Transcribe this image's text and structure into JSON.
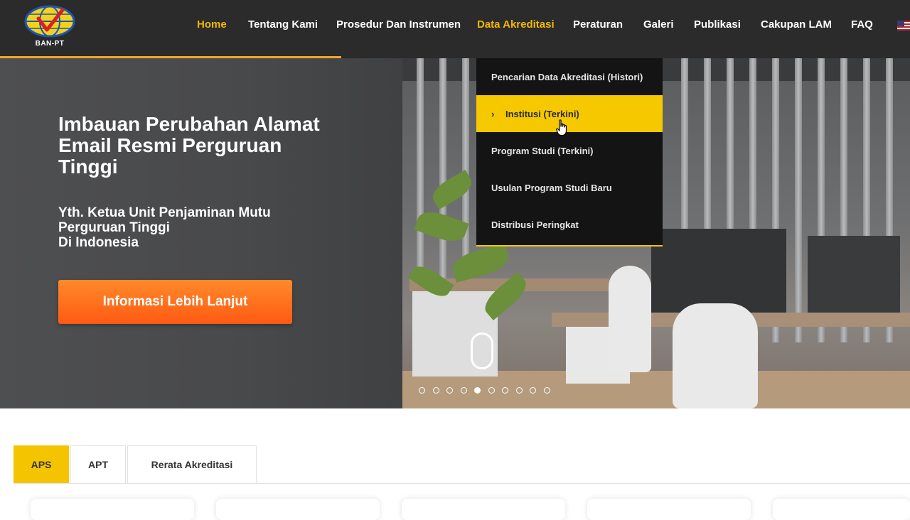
{
  "logo": {
    "text": "BAN-PT"
  },
  "nav": {
    "items": [
      {
        "label": "Home"
      },
      {
        "label": "Tentang Kami"
      },
      {
        "label": "Prosedur Dan Instrumen"
      },
      {
        "label": "Data Akreditasi"
      },
      {
        "label": "Peraturan"
      },
      {
        "label": "Galeri"
      },
      {
        "label": "Publikasi"
      },
      {
        "label": "Cakupan LAM"
      },
      {
        "label": "FAQ"
      }
    ],
    "active_color": "#f5b800"
  },
  "dropdown": {
    "items": [
      {
        "label": "Pencarian Data Akreditasi (Histori)"
      },
      {
        "label": "Institusi (Terkini)",
        "chevron": "›"
      },
      {
        "label": "Program Studi (Terkini)"
      },
      {
        "label": "Usulan Program Studi Baru"
      },
      {
        "label": "Distribusi Peringkat"
      }
    ],
    "hover_color": "#f5c800"
  },
  "hero": {
    "title": "Imbauan Perubahan Alamat Email Resmi Perguruan Tinggi",
    "subtitle": "Yth. Ketua Unit Penjaminan Mutu\nPerguruan Tinggi\nDi Indonesia",
    "button_label": "Informasi Lebih Lanjut",
    "button_color": "#ff6a1a",
    "slides_total": 10,
    "active_slide": 5
  },
  "tabs": {
    "items": [
      {
        "label": "APS"
      },
      {
        "label": "APT"
      },
      {
        "label": "Rerata Akreditasi"
      }
    ],
    "active_color": "#f5c400"
  },
  "icons": {
    "flag": "us-flag-icon",
    "cursor": "hand-pointer-cursor-icon",
    "scroll": "mouse-scroll-icon"
  }
}
